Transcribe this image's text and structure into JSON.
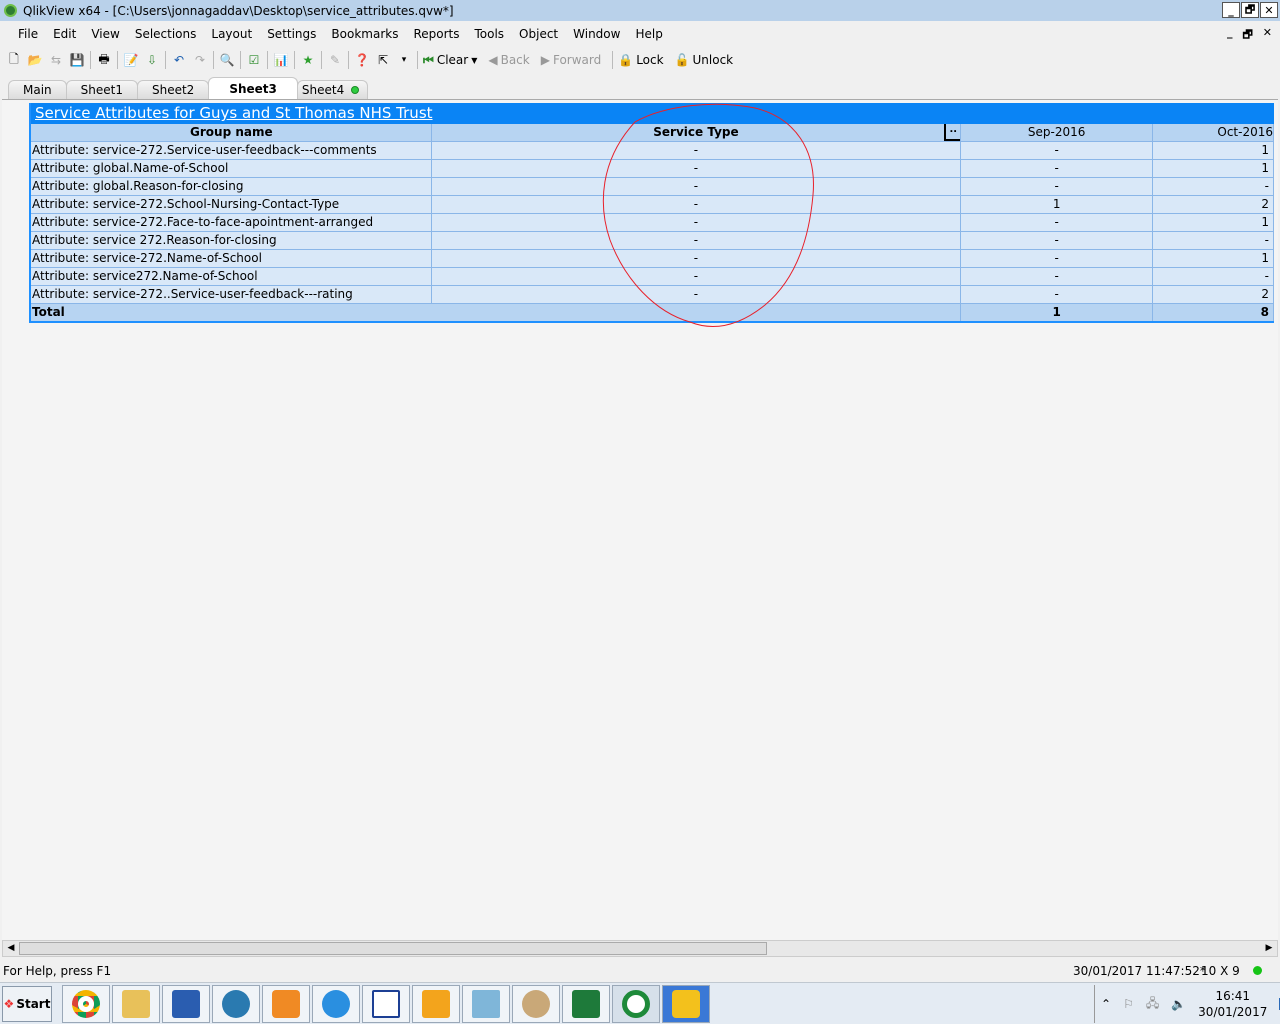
{
  "window": {
    "title": "QlikView x64 - [C:\\Users\\jonnagaddav\\Desktop\\service_attributes.qvw*]",
    "minimize": "_",
    "restore": "🗗",
    "close": "✕"
  },
  "menu": [
    "File",
    "Edit",
    "View",
    "Selections",
    "Layout",
    "Settings",
    "Bookmarks",
    "Reports",
    "Tools",
    "Object",
    "Window",
    "Help"
  ],
  "toolbar": {
    "clear": "Clear",
    "back": "Back",
    "forward": "Forward",
    "lock": "Lock",
    "unlock": "Unlock"
  },
  "tabs": [
    {
      "label": "Main"
    },
    {
      "label": "Sheet1"
    },
    {
      "label": "Sheet2"
    },
    {
      "label": "Sheet3",
      "active": true
    },
    {
      "label": "Sheet4"
    }
  ],
  "table": {
    "caption": "Service Attributes for Guys and St Thomas NHS Trust",
    "headers": [
      "Group name",
      "Service Type",
      "Sep-2016",
      "Oct-2016"
    ],
    "sort_indicator": "..",
    "rows": [
      [
        "Attribute:  service-272.Service-user-feedback---comments",
        "-",
        "-",
        "1"
      ],
      [
        "Attribute: global.Name-of-School",
        "-",
        "-",
        "1"
      ],
      [
        "Attribute: global.Reason-for-closing",
        "-",
        "-",
        "-"
      ],
      [
        "Attribute:  service-272.School-Nursing-Contact-Type",
        "-",
        "1",
        "2"
      ],
      [
        "Attribute:  service-272.Face-to-face-apointment-arranged",
        "-",
        "-",
        "1"
      ],
      [
        "Attribute: service 272.Reason-for-closing",
        "-",
        "-",
        "-"
      ],
      [
        "Attribute: service-272.Name-of-School",
        "-",
        "-",
        "1"
      ],
      [
        "Attribute: service272.Name-of-School",
        "-",
        "-",
        "-"
      ],
      [
        "Attribute:  service-272..Service-user-feedback---rating",
        "-",
        "-",
        "2"
      ]
    ],
    "total": {
      "label": "Total",
      "sep": "1",
      "oct": "8"
    }
  },
  "annotation_color": "#e8202a",
  "status": {
    "help": "For Help, press F1",
    "timestamp": "30/01/2017 11:47:52*",
    "dimensions": "10 X 9"
  },
  "taskbar": {
    "start": "Start",
    "time": "16:41",
    "date": "30/01/2017"
  }
}
